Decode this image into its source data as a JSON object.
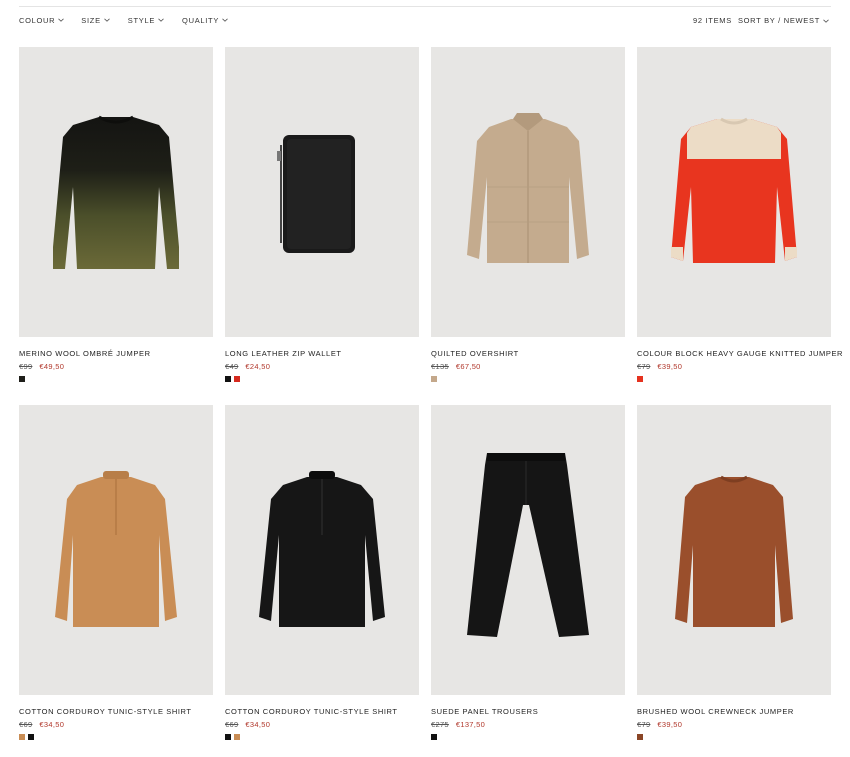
{
  "filters": [
    {
      "label": "COLOUR"
    },
    {
      "label": "SIZE"
    },
    {
      "label": "STYLE"
    },
    {
      "label": "QUALITY"
    }
  ],
  "item_count": "92 ITEMS",
  "sort_label": "SORT BY / NEWEST",
  "products": [
    {
      "name": "MERINO WOOL OMBRÉ JUMPER",
      "old_price": "€99",
      "price": "€49,50",
      "swatches": [
        "#1f1f1a"
      ],
      "image": "ombre-jumper"
    },
    {
      "name": "LONG LEATHER ZIP WALLET",
      "old_price": "€49",
      "price": "€24,50",
      "swatches": [
        "#111111",
        "#d62a1f"
      ],
      "image": "zip-wallet"
    },
    {
      "name": "QUILTED OVERSHIRT",
      "old_price": "€135",
      "price": "€67,50",
      "swatches": [
        "#c4a88b"
      ],
      "image": "quilted-overshirt"
    },
    {
      "name": "COLOUR BLOCK HEAVY GAUGE KNITTED JUMPER",
      "old_price": "€79",
      "price": "€39,50",
      "swatches": [
        "#e5321f"
      ],
      "image": "colour-block-jumper"
    },
    {
      "name": "COTTON CORDUROY TUNIC-STYLE SHIRT",
      "old_price": "€69",
      "price": "€34,50",
      "swatches": [
        "#c98d55",
        "#111111"
      ],
      "image": "tunic-shirt-tan"
    },
    {
      "name": "COTTON CORDUROY TUNIC-STYLE SHIRT",
      "old_price": "€69",
      "price": "€34,50",
      "swatches": [
        "#111111",
        "#c98d55"
      ],
      "image": "tunic-shirt-black"
    },
    {
      "name": "SUEDE PANEL TROUSERS",
      "old_price": "€275",
      "price": "€137,50",
      "swatches": [
        "#111111"
      ],
      "image": "suede-trousers"
    },
    {
      "name": "BRUSHED WOOL CREWNECK JUMPER",
      "old_price": "€79",
      "price": "€39,50",
      "swatches": [
        "#8a4526"
      ],
      "image": "brushed-jumper"
    }
  ]
}
